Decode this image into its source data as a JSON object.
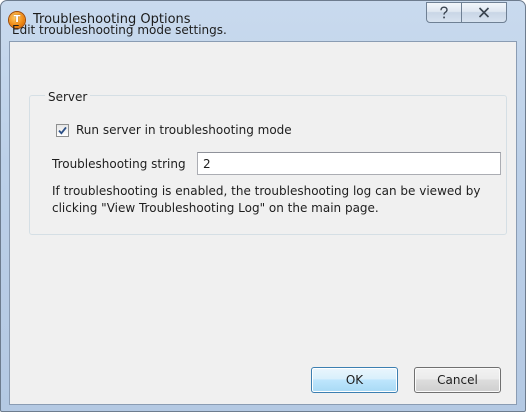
{
  "window": {
    "title": "Troubleshooting Options",
    "icon_letter": "T",
    "icon": "app-logo-icon",
    "help_glyph": "?",
    "help_icon": "help-icon",
    "close_icon": "close-icon"
  },
  "dialog": {
    "description": "Edit troubleshooting mode settings.",
    "server_group": {
      "legend": "Server",
      "run_checkbox": {
        "label": "Run server in troubleshooting mode",
        "checked": true
      },
      "troubleshooting_string": {
        "label": "Troubleshooting string",
        "value": "2"
      },
      "info": "If troubleshooting is enabled, the troubleshooting log can be viewed by clicking \"View Troubleshooting Log\" on the main page."
    }
  },
  "buttons": {
    "ok_label": "OK",
    "cancel_label": "Cancel"
  },
  "colors": {
    "titlebar": "#bcd0e8",
    "client_background": "#f0f0f0",
    "default_button_border": "#3c7fb1",
    "checkmark": "#2b4f86"
  }
}
